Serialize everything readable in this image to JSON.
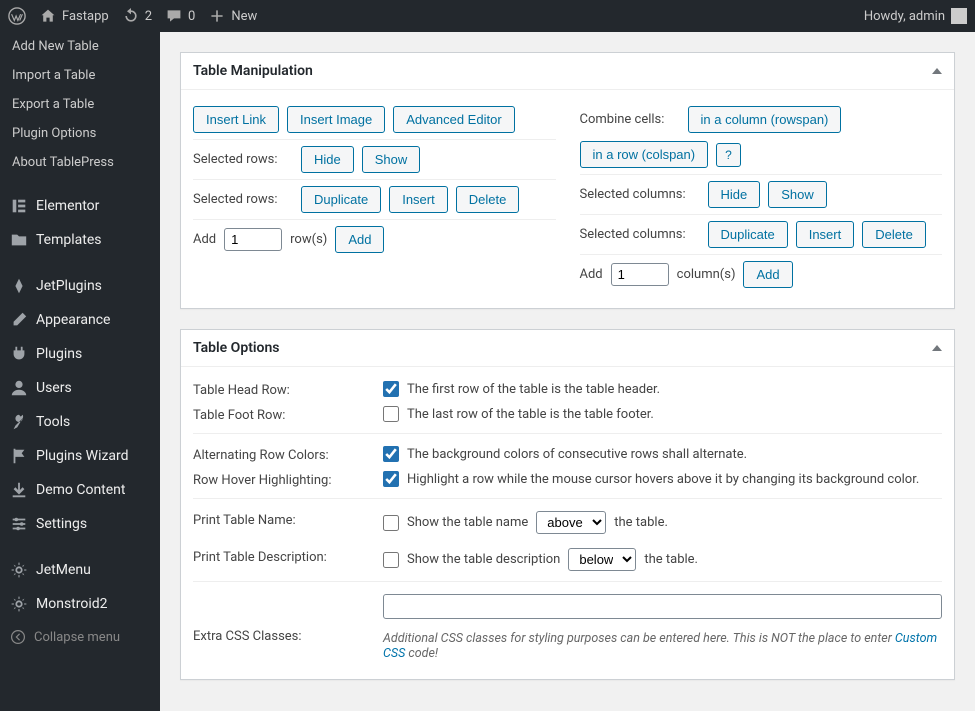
{
  "adminbar": {
    "site_name": "Fastapp",
    "updates": "2",
    "comments": "0",
    "new": "New",
    "howdy": "Howdy, admin"
  },
  "sidebar": {
    "sub": [
      "Add New Table",
      "Import a Table",
      "Export a Table",
      "Plugin Options",
      "About TablePress"
    ],
    "main": [
      "Elementor",
      "Templates",
      "JetPlugins",
      "Appearance",
      "Plugins",
      "Users",
      "Tools",
      "Plugins Wizard",
      "Demo Content",
      "Settings",
      "JetMenu",
      "Monstroid2"
    ],
    "collapse": "Collapse menu"
  },
  "manip": {
    "title": "Table Manipulation",
    "insert_link": "Insert Link",
    "insert_image": "Insert Image",
    "advanced_editor": "Advanced Editor",
    "combine_cells": "Combine cells:",
    "rowspan": "in a column (rowspan)",
    "colspan": "in a row (colspan)",
    "q": "?",
    "sel_rows": "Selected rows:",
    "sel_cols": "Selected columns:",
    "hide": "Hide",
    "show": "Show",
    "duplicate": "Duplicate",
    "insert": "Insert",
    "delete": "Delete",
    "add": "Add",
    "add_rows_val": "1",
    "add_rows_suffix": "row(s)",
    "add_cols_val": "1",
    "add_cols_suffix": "column(s)",
    "add_prefix": "Add"
  },
  "opts": {
    "title": "Table Options",
    "head_row_lbl": "Table Head Row:",
    "head_row_txt": "The first row of the table is the table header.",
    "foot_row_lbl": "Table Foot Row:",
    "foot_row_txt": "The last row of the table is the table footer.",
    "alt_lbl": "Alternating Row Colors:",
    "alt_txt": "The background colors of consecutive rows shall alternate.",
    "hover_lbl": "Row Hover Highlighting:",
    "hover_txt": "Highlight a row while the mouse cursor hovers above it by changing its background color.",
    "print_name_lbl": "Print Table Name:",
    "print_name_pre": "Show the table name",
    "print_name_sel": "above",
    "print_name_post": "the table.",
    "print_desc_lbl": "Print Table Description:",
    "print_desc_pre": "Show the table description",
    "print_desc_sel": "below",
    "print_desc_post": "the table.",
    "css_lbl": "Extra CSS Classes:",
    "css_help_a": "Additional CSS classes for styling purposes can be entered here. This is NOT the place to enter ",
    "css_help_link": "Custom CSS",
    "css_help_b": " code!"
  }
}
